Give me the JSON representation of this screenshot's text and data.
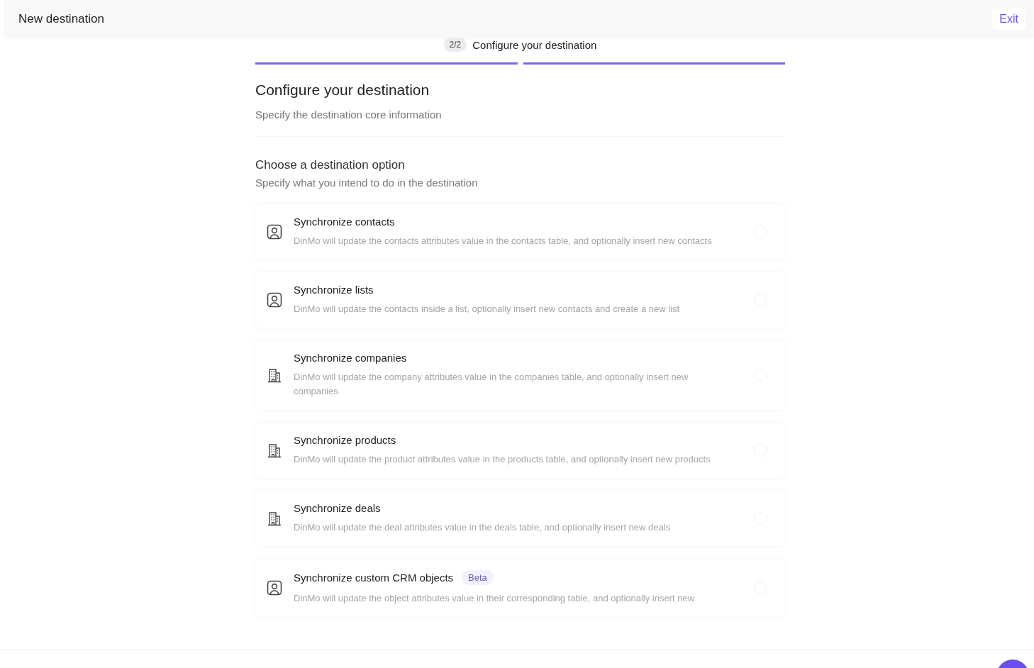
{
  "header": {
    "title": "New destination",
    "exit": "Exit"
  },
  "stepper": {
    "badge": "2/2",
    "label": "Configure your destination",
    "steps": [
      {
        "done": true
      },
      {
        "done": true
      }
    ]
  },
  "page": {
    "title": "Configure your destination",
    "subtitle": "Specify the destination core information"
  },
  "section": {
    "title": "Choose a destination option",
    "subtitle": "Specify what you intend to do in the destination"
  },
  "options": [
    {
      "kind": "person",
      "title": "Synchronize contacts",
      "description": "DinMo will update the contacts attributes value in the contacts table, and optionally insert new contacts",
      "selected": false
    },
    {
      "kind": "person",
      "title": "Synchronize lists",
      "description": "DinMo will update the contacts inside a list, optionally insert new contacts and create a new list",
      "selected": false
    },
    {
      "kind": "building",
      "title": "Synchronize companies",
      "description": "DinMo will update the company attributes value in the companies table, and optionally insert new companies",
      "selected": false
    },
    {
      "kind": "building",
      "title": "Synchronize products",
      "description": "DinMo will update the product attributes value in the products table, and optionally insert new products",
      "selected": false
    },
    {
      "kind": "building",
      "title": "Synchronize deals",
      "description": "DinMo will update the deal attributes value in the deals table, and optionally insert new deals",
      "selected": false
    },
    {
      "kind": "person",
      "title": "Synchronize custom CRM objects",
      "badge": "Beta",
      "description": "DinMo will update the object attributes value in their corresponding table, and optionally insert new",
      "selected": false
    }
  ]
}
